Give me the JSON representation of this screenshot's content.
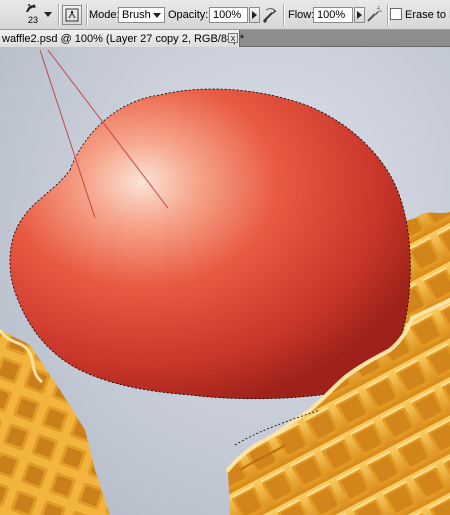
{
  "options_bar": {
    "brush_size": "23",
    "mode_label": "Mode:",
    "mode_value": "Brush",
    "opacity_label": "Opacity:",
    "opacity_value": "100%",
    "flow_label": "Flow:",
    "flow_value": "100%",
    "erase_label": "Erase to Hist"
  },
  "document_tab": {
    "title": "waffle2.psd @ 100% (Layer 27 copy 2, RGB/8#) *",
    "close_glyph": "x"
  },
  "colors": {
    "ice_cream_light": "#fbd3c4",
    "ice_cream_mid": "#e8533e",
    "ice_cream_dark": "#b92a1f",
    "waffle_light": "#f5b53e",
    "waffle_dark": "#c97b12",
    "guide_line": "#c4454a"
  }
}
